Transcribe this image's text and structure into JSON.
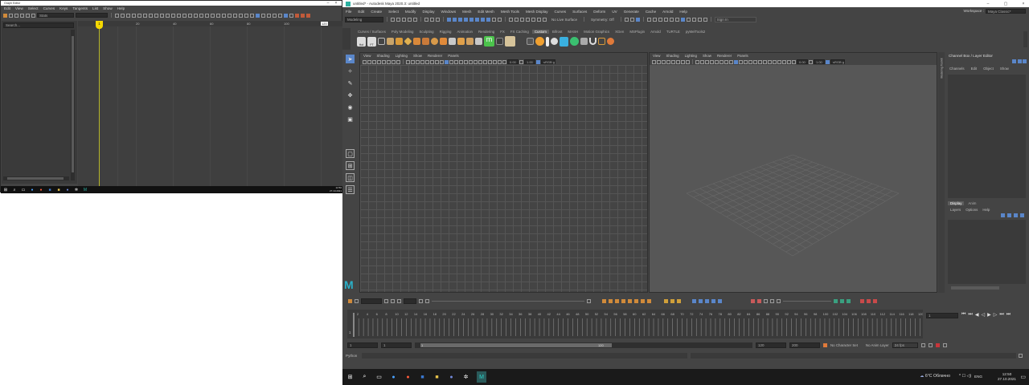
{
  "graph_editor": {
    "title": "Graph Editor",
    "menu": [
      "Edit",
      "View",
      "Select",
      "Curves",
      "Keys",
      "Tangents",
      "List",
      "Show",
      "Help"
    ],
    "stats_label": "Stats",
    "search_placeholder": "Search...",
    "ruler_ticks": [
      "20",
      "40",
      "60",
      "80",
      "100",
      "120"
    ],
    "current_frame": "1",
    "taskbar_clock_time": "12:50",
    "taskbar_clock_date": "27.10.2021"
  },
  "maya": {
    "title": "untitled* - Autodesk Maya 2020.3: untitled",
    "menu": [
      "File",
      "Edit",
      "Create",
      "Select",
      "Modify",
      "Display",
      "Windows",
      "Mesh",
      "Edit Mesh",
      "Mesh Tools",
      "Mesh Display",
      "Curves",
      "Surfaces",
      "Deform",
      "UV",
      "Generate",
      "Cache",
      "Arnold",
      "Help"
    ],
    "workspace_label": "Workspace :",
    "workspace_value": "Maya Classic*",
    "menu_set": "Modeling",
    "no_live_surface": "No Live Surface",
    "symmetry": "Symmetry: Off",
    "sign_in": "Sign In",
    "shelf_tabs": [
      "Curves / Surfaces",
      "Poly Modeling",
      "Sculpting",
      "Rigging",
      "Animation",
      "Rendering",
      "FX",
      "FX Caching",
      "Custom",
      "Bifrost",
      "MASH",
      "Motion Graphics",
      "XGen",
      "MSPlugin",
      "Arnold",
      "TURTLE",
      "pyMelTools2"
    ],
    "shelf_active": "Custom",
    "shelf_labels": [
      "Hot",
      "FT"
    ],
    "viewport_menu": [
      "View",
      "Shading",
      "Lighting",
      "Show",
      "Renderer",
      "Panels"
    ],
    "viewport_fields": {
      "near": "0.00",
      "far": "1.00",
      "color_space": "sRGB g"
    },
    "channel_box_title": "Channel Box / Layer Editor",
    "channel_menu": [
      "Channels",
      "Edit",
      "Object",
      "Show"
    ],
    "layer_tabs": [
      "Display",
      "Anim"
    ],
    "layer_menu": [
      "Layers",
      "Options",
      "Help"
    ],
    "side_tab": "Modeling Toolkit",
    "timeline_ticks": [
      "2",
      "4",
      "6",
      "8",
      "10",
      "12",
      "14",
      "16",
      "18",
      "20",
      "22",
      "24",
      "26",
      "28",
      "30",
      "32",
      "34",
      "36",
      "38",
      "40",
      "42",
      "44",
      "46",
      "48",
      "50",
      "52",
      "54",
      "56",
      "58",
      "60",
      "62",
      "64",
      "66",
      "68",
      "70",
      "72",
      "74",
      "76",
      "78",
      "80",
      "82",
      "84",
      "86",
      "88",
      "90",
      "92",
      "94",
      "96",
      "98",
      "100",
      "102",
      "104",
      "106",
      "108",
      "110",
      "112",
      "114",
      "116",
      "118",
      "120"
    ],
    "current_frame": "1",
    "range": {
      "start": "1",
      "inner_start": "1",
      "slider_start": "1",
      "slider_end": "120",
      "end": "120",
      "outer_end": "200"
    },
    "no_character_set": "No Character Set",
    "no_anim_layer": "No Anim Layer",
    "fps": "24 fps",
    "python_label": "Python"
  },
  "taskbar": {
    "weather": "6°C Облачно",
    "lang": "ENG",
    "time": "12:50",
    "date": "27.10.2021"
  },
  "colors": {
    "maya_blue": "#5a86c9",
    "keyframe_yellow": "#f5d800",
    "range_red": "#c8353a"
  }
}
